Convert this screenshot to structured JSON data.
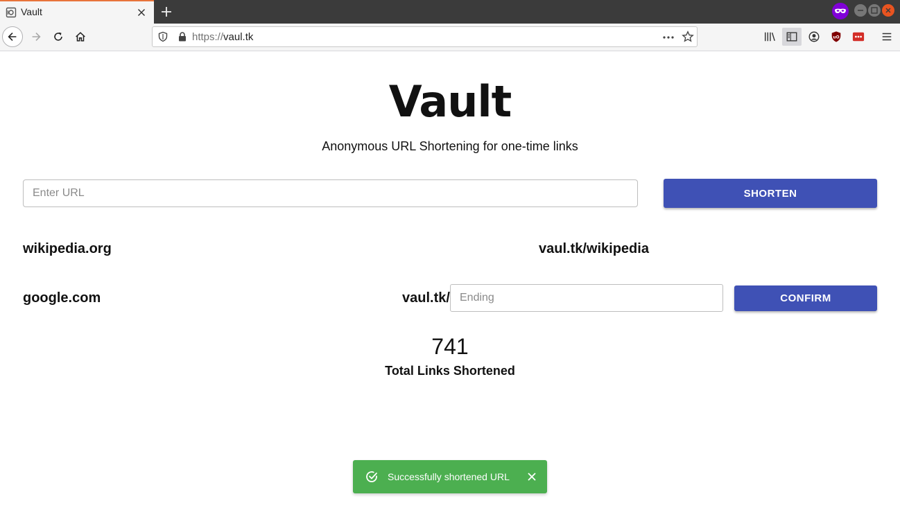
{
  "browser": {
    "tab_title": "Vault",
    "url_scheme": "https://",
    "url_host": "vaul.tk",
    "accent_color": "#e8743b"
  },
  "page": {
    "title": "Vault",
    "subtitle": "Anonymous URL Shortening for one-time links",
    "url_input_placeholder": "Enter URL",
    "shorten_label": "SHORTEN",
    "links": [
      {
        "original": "wikipedia.org",
        "short": "vaul.tk/wikipedia"
      },
      {
        "original": "google.com",
        "short_prefix": "vaul.tk/",
        "ending_placeholder": "Ending",
        "confirm_label": "CONFIRM"
      }
    ],
    "total_count": "741",
    "total_label": "Total Links Shortened",
    "primary_color": "#3f51b5"
  },
  "toast": {
    "message": "Successfully shortened URL",
    "color": "#4caf50"
  }
}
